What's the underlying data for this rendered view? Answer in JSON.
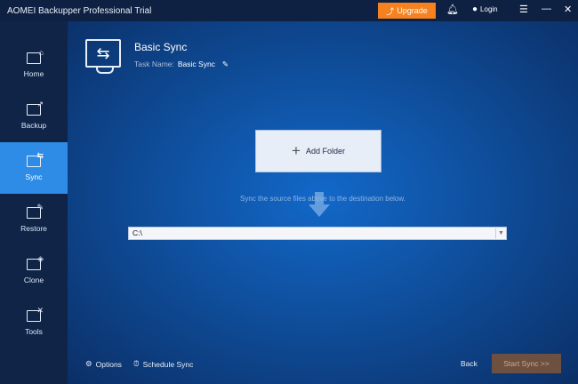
{
  "window": {
    "title": "AOMEI Backupper Professional Trial",
    "upgrade": "Upgrade",
    "login": "Login",
    "menu_icon": "☰",
    "minimize_icon": "—",
    "close_icon": "✕"
  },
  "sidebar": {
    "items": [
      {
        "label": "Home",
        "icon": "⌂"
      },
      {
        "label": "Backup",
        "icon": "↗"
      },
      {
        "label": "Sync",
        "icon": "⇆"
      },
      {
        "label": "Restore",
        "icon": "✎"
      },
      {
        "label": "Clone",
        "icon": "◈"
      },
      {
        "label": "Tools",
        "icon": "✕"
      }
    ]
  },
  "header": {
    "title": "Basic Sync",
    "task_label": "Task Name:",
    "task_name": "Basic Sync"
  },
  "content": {
    "add_folder": "Add Folder",
    "hint": "Sync the source files above to the destination below.",
    "destination": "C:\\"
  },
  "footer": {
    "options": "Options",
    "schedule": "Schedule Sync",
    "back": "Back",
    "start": "Start Sync >>"
  }
}
